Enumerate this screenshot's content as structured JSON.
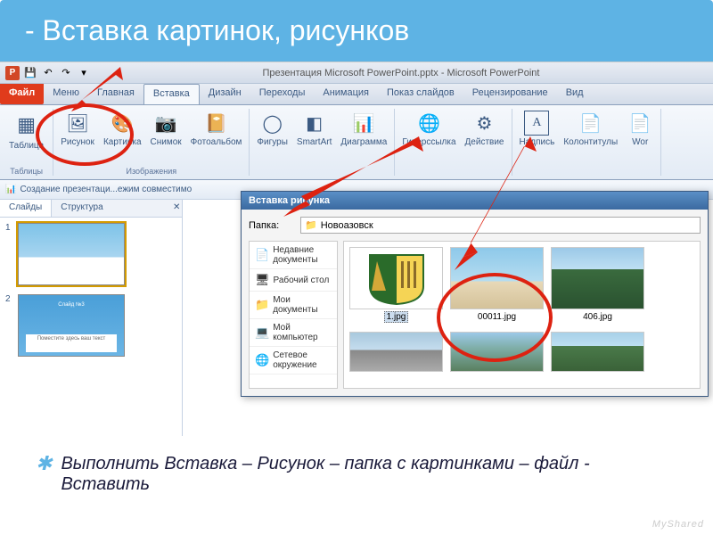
{
  "title": "- Вставка картинок, рисунков",
  "qat": {
    "window_title": "Презентация Microsoft PowerPoint.pptx - Microsoft PowerPoint"
  },
  "tabs": {
    "file": "Файл",
    "items": [
      "Меню",
      "Главная",
      "Вставка",
      "Дизайн",
      "Переходы",
      "Анимация",
      "Показ слайдов",
      "Рецензирование",
      "Вид"
    ],
    "active_index": 2
  },
  "ribbon": {
    "groups": [
      {
        "label": "Таблицы",
        "buttons": [
          {
            "name": "table",
            "label": "Таблица",
            "icon": "▦"
          }
        ]
      },
      {
        "label": "Изображения",
        "buttons": [
          {
            "name": "picture",
            "label": "Рисунок",
            "icon": "🖼"
          },
          {
            "name": "clipart",
            "label": "Картинка",
            "icon": "🎨"
          },
          {
            "name": "screenshot",
            "label": "Снимок",
            "icon": "📷"
          },
          {
            "name": "album",
            "label": "Фотоальбом",
            "icon": "📔"
          }
        ]
      },
      {
        "label": "",
        "buttons": [
          {
            "name": "shapes",
            "label": "Фигуры",
            "icon": "◯"
          },
          {
            "name": "smartart",
            "label": "SmartArt",
            "icon": "◧"
          },
          {
            "name": "chart",
            "label": "Диаграмма",
            "icon": "📊"
          }
        ]
      },
      {
        "label": "",
        "buttons": [
          {
            "name": "hyperlink",
            "label": "Гиперссылка",
            "icon": "🌐"
          },
          {
            "name": "action",
            "label": "Действие",
            "icon": "⚙"
          }
        ]
      },
      {
        "label": "",
        "buttons": [
          {
            "name": "textbox",
            "label": "Надпись",
            "icon": "A"
          },
          {
            "name": "headerfooter",
            "label": "Колонтитулы",
            "icon": "📄"
          },
          {
            "name": "wordart",
            "label": "Wor",
            "icon": "📄"
          }
        ]
      }
    ]
  },
  "doc_bar": "Создание презентаци...ежим совместимо",
  "panel": {
    "tabs": {
      "slides": "Слайды",
      "outline": "Структура"
    },
    "thumbs": [
      {
        "num": "1"
      },
      {
        "num": "2",
        "title": "Слайд №3",
        "sub": "Поместите здесь ваш текст"
      }
    ]
  },
  "dialog": {
    "title": "Вставка рисунка",
    "folder_label": "Папка:",
    "folder_value": "Новоазовск",
    "places": [
      {
        "icon": "📄",
        "label": "Недавние документы"
      },
      {
        "icon": "🖥",
        "label": "Рабочий стол"
      },
      {
        "icon": "📁",
        "label": "Мои документы"
      },
      {
        "icon": "💻",
        "label": "Мой компьютер"
      },
      {
        "icon": "🌐",
        "label": "Сетевое окружение"
      }
    ],
    "files": [
      {
        "name": "1.jpg",
        "selected": true,
        "kind": "emblem"
      },
      {
        "name": "00011.jpg",
        "kind": "beach"
      },
      {
        "name": "406.jpg",
        "kind": "trees"
      },
      {
        "name": "",
        "kind": "city"
      },
      {
        "name": "",
        "kind": "path"
      },
      {
        "name": "",
        "kind": "park"
      }
    ]
  },
  "footer": "Выполнить Вставка – Рисунок – папка с картинками – файл - Вставить",
  "watermark": "MyShared"
}
